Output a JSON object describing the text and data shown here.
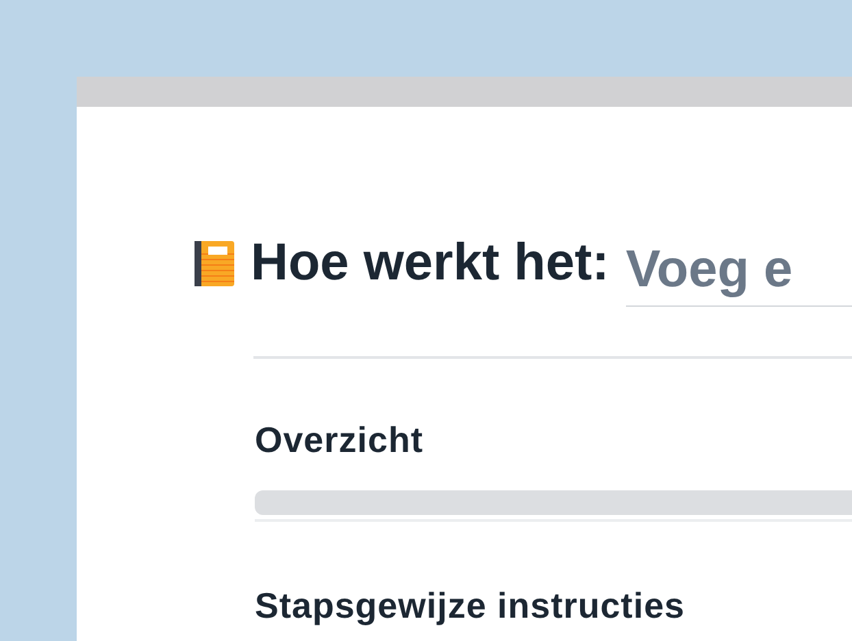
{
  "heading": {
    "label": "Hoe werkt het:",
    "title_field": {
      "placeholder": "Voeg e"
    }
  },
  "sections": [
    {
      "title": "Overzicht",
      "kind": "skeleton"
    },
    {
      "title": "Stapsgewijze instructies",
      "kind": "plain"
    }
  ]
}
